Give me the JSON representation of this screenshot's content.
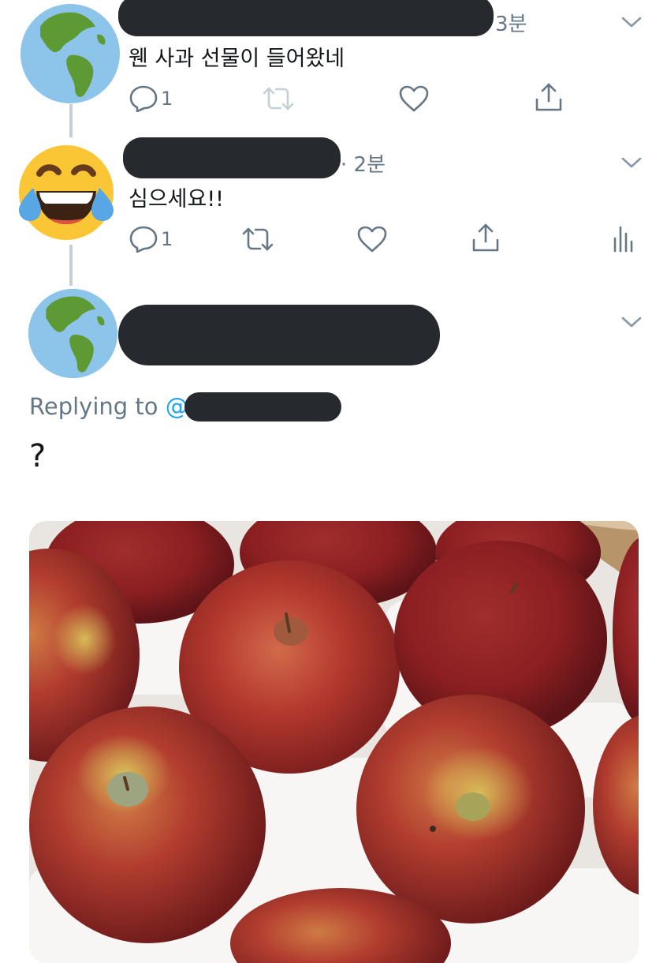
{
  "tweets": [
    {
      "time": "3분",
      "text": "웬 사과 선물이 들어왔네",
      "reply_count": "1",
      "avatar": "globe-americas-icon"
    },
    {
      "time": "· 2분",
      "text": "심으세요!!",
      "reply_count": "1",
      "avatar": "face-with-tears-of-joy-icon"
    },
    {
      "avatar": "globe-americas-icon"
    }
  ],
  "reply": {
    "replying_prefix": "Replying to ",
    "at": "@",
    "text": "?"
  },
  "colors": {
    "accent": "#1da1f2",
    "muted": "#657786",
    "redaction": "#262a2f"
  }
}
